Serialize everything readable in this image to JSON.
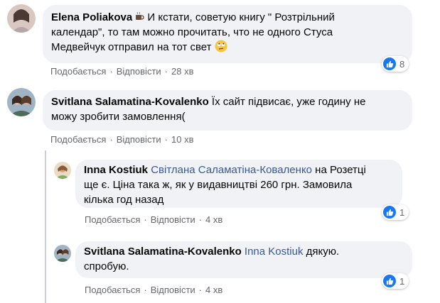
{
  "comments": [
    {
      "author": "Elena Poliakova",
      "text_line1": " И кстати, советую книгу \" Розтрільний",
      "text_line2": "календар\", то там можно прочитать, что не одного Стуса",
      "text_line3": "Медвейчук отправил на тот свет",
      "like_label": "Подобається",
      "reply_label": "Відповісти",
      "time": "28 хв",
      "reaction_count": "8",
      "icons": [
        "coffee-emoji-icon",
        "rolling-eyes-emoji-icon"
      ]
    },
    {
      "author": "Svitlana Salamatina-Kovalenko",
      "text_line1": " Їх сайт підвисає, уже годину не",
      "text_line2": "можу зробити замовлення(",
      "like_label": "Подобається",
      "reply_label": "Відповісти",
      "time": "10 хв"
    }
  ],
  "replies": [
    {
      "author": "Inna Kostiuk",
      "mention": "Світлана Саламатіна-Коваленко",
      "text_line1_rest": " на Розетці",
      "text_line2": "ще є. Ціна така ж, як у видавництві 260 грн. Замовила",
      "text_line3": "кілька год назад",
      "like_label": "Подобається",
      "reply_label": "Відповісти",
      "time": "4 хв",
      "reaction_count": "1"
    },
    {
      "author": "Svitlana Salamatina-Kovalenko",
      "mention": "Inna Kostiuk",
      "text_line1_rest": " дякую.",
      "text_line2": "спробую.",
      "like_label": "Подобається",
      "reply_label": "Відповісти",
      "time": "4 хв",
      "reaction_count": "1"
    }
  ],
  "separator": "·",
  "colors": {
    "bubble": "#f0f2f5",
    "mention": "#385898",
    "meta": "#65676b",
    "like": "#1877f2"
  }
}
